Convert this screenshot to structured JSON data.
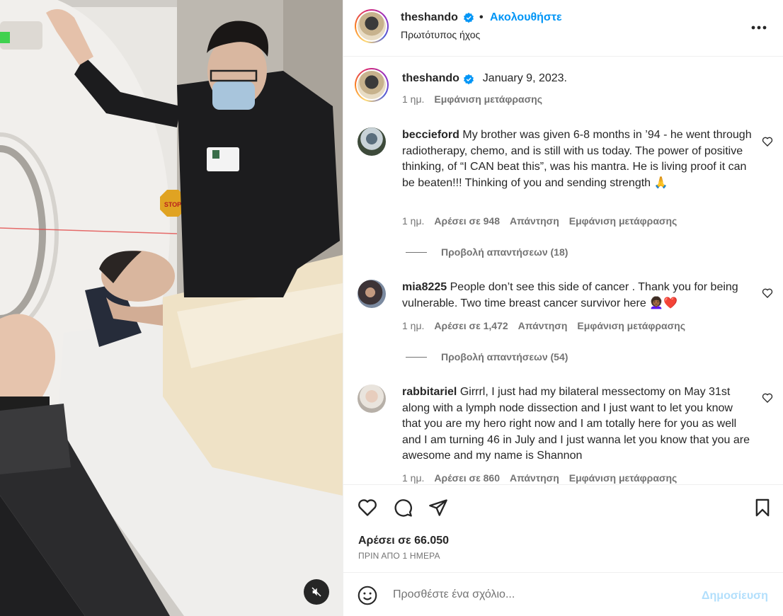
{
  "header": {
    "username": "theshando",
    "follow_label": "Ακολουθήστε",
    "audio_label": "Πρωτότυπος ήχος",
    "more_label": "•••"
  },
  "caption": {
    "username": "theshando",
    "text": "January 9, 2023.",
    "time": "1 ημ.",
    "translate": "Εμφάνιση μετάφρασης"
  },
  "comments": [
    {
      "username": "beccieford",
      "text": "My brother was given 6-8 months in ’94 - he went through radiotherapy, chemo, and is still with us today. The power of positive thinking, of “I CAN beat this”, was his mantra. He is living proof it can be beaten!!! Thinking of you and sending strength 🙏",
      "time": "1 ημ.",
      "likes": "Αρέσει σε 948",
      "reply": "Απάντηση",
      "translate": "Εμφάνιση μετάφρασης",
      "view_replies": "Προβολή απαντήσεων (18)"
    },
    {
      "username": "mia8225",
      "text": "People don’t see this side of cancer . Thank you for being vulnerable. Two time breast cancer survivor here 👩🏾‍🦱❤️",
      "time": "1 ημ.",
      "likes": "Αρέσει σε 1,472",
      "reply": "Απάντηση",
      "translate": "Εμφάνιση μετάφρασης",
      "view_replies": "Προβολή απαντήσεων (54)"
    },
    {
      "username": "rabbitariel",
      "text": "Girrrl, I just had my bilateral messectomy on May 31st along with a lymph node dissection and I just want to let you know that you are my hero right now and I am totally here for you as well and I am turning 46 in July and I just wanna let you know that you are awesome and my name is Shannon",
      "time": "1 ημ.",
      "likes": "Αρέσει σε 860",
      "reply": "Απάντηση",
      "translate": "Εμφάνιση μετάφρασης"
    }
  ],
  "actions": {
    "likes_label": "Αρέσει σε 66.050",
    "time_ago": "ΠΡΙΝ ΑΠΟ 1 ΗΜΕΡΑ",
    "icons": [
      "heart-icon",
      "comment-icon",
      "share-icon",
      "bookmark-icon"
    ]
  },
  "composer": {
    "placeholder": "Προσθέστε ένα σχόλιο...",
    "post_label": "Δημοσίευση"
  },
  "media": {
    "sign_text": "STOP",
    "mute_icon": "muted-speaker-icon"
  },
  "colors": {
    "accent": "#0095f6",
    "verified": "#0095f6",
    "post_disabled": "#b2dffc",
    "secondary_text": "#737373"
  }
}
